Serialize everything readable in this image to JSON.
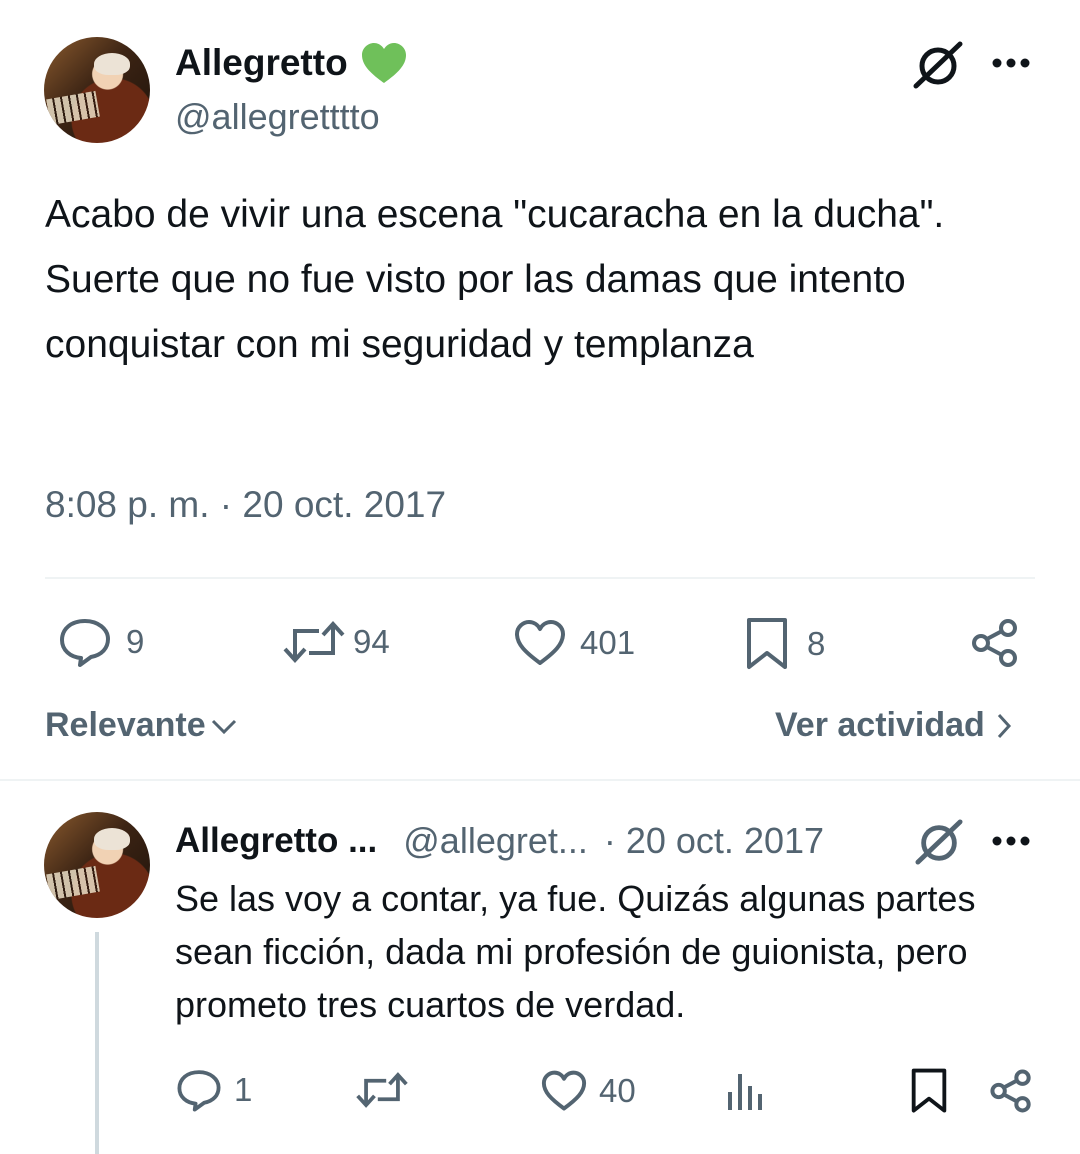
{
  "main_tweet": {
    "author": {
      "name": "Allegretto",
      "handle": "@allegretttto",
      "badge_icon": "green-heart-icon",
      "badge_color": "#6fc05a"
    },
    "text": "Acabo de vivir una escena \"cucaracha en la ducha\". Suerte que no fue visto por las damas que intento conquistar con mi seguridad y templanza",
    "timestamp": "8:08 p. m. · 20 oct. 2017",
    "stats": {
      "replies": "9",
      "retweets": "94",
      "likes": "401",
      "bookmarks": "8"
    }
  },
  "sort_bar": {
    "sort_label": "Relevante",
    "activity_label": "Ver actividad"
  },
  "reply": {
    "author": {
      "name": "Allegretto ...",
      "handle": "@allegret...",
      "date": "· 20 oct. 2017"
    },
    "text": "Se las voy a contar, ya fue. Quizás algunas partes sean ficción, dada mi profesión de guionista, pero prometo tres cuartos de verdad.",
    "stats": {
      "replies": "1",
      "likes": "40"
    }
  },
  "colors": {
    "text_primary": "#0f1419",
    "text_secondary": "#536471",
    "divider": "#eff3f4"
  }
}
